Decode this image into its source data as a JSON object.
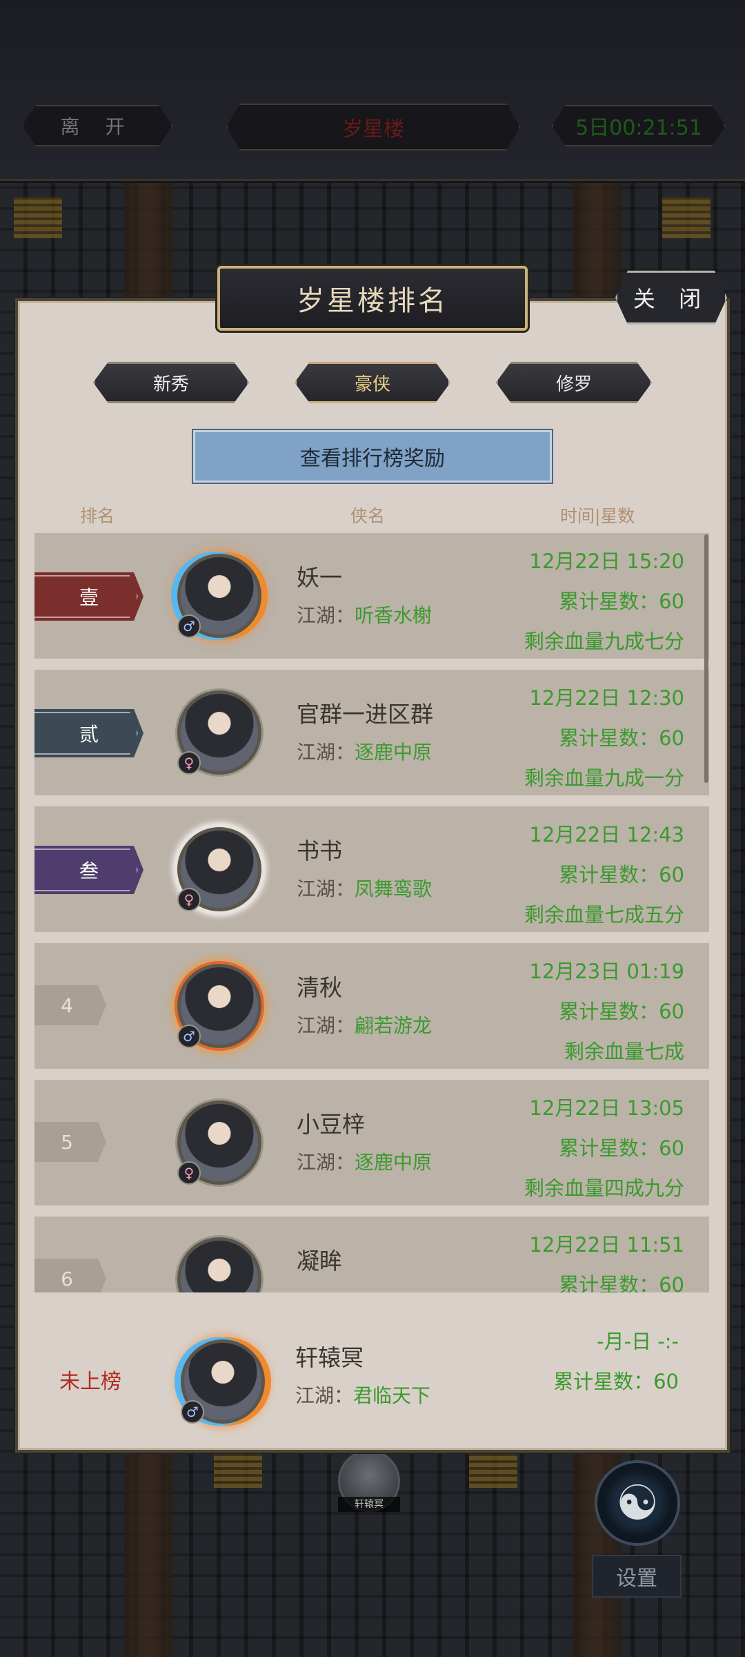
{
  "top_bar": {
    "leave_label": "离 开",
    "location_title": "岁星楼",
    "timer": "5日00:21:51"
  },
  "panel": {
    "title": "岁星楼排名",
    "close_label": "关 闭",
    "tabs": [
      {
        "label": "新秀",
        "active": false
      },
      {
        "label": "豪侠",
        "active": true
      },
      {
        "label": "修罗",
        "active": false
      }
    ],
    "reward_button": "查看排行榜奖励",
    "columns": {
      "rank": "排名",
      "name": "侠名",
      "time": "时间|星数"
    },
    "guild_prefix": "江湖：",
    "rows": [
      {
        "rank": "壹",
        "name": "妖一",
        "guild": "听香水榭",
        "time": "12月22日 15:20",
        "stars": "累计星数：60",
        "hp": "剩余血量九成七分",
        "gender": "♂",
        "frame": "fireice"
      },
      {
        "rank": "贰",
        "name": "官群一进区群",
        "guild": "逐鹿中原",
        "time": "12月22日 12:30",
        "stars": "累计星数：60",
        "hp": "剩余血量九成一分",
        "gender": "♀",
        "frame": "plain"
      },
      {
        "rank": "叁",
        "name": "书书",
        "guild": "凤舞鸾歌",
        "time": "12月22日 12:43",
        "stars": "累计星数：60",
        "hp": "剩余血量七成五分",
        "gender": "♀",
        "frame": "cloud"
      },
      {
        "rank": "4",
        "name": "清秋",
        "guild": "翩若游龙",
        "time": "12月23日 01:19",
        "stars": "累计星数：60",
        "hp": "剩余血量七成",
        "gender": "♂",
        "frame": "fire"
      },
      {
        "rank": "5",
        "name": "小豆梓",
        "guild": "逐鹿中原",
        "time": "12月22日 13:05",
        "stars": "累计星数：60",
        "hp": "剩余血量四成九分",
        "gender": "♀",
        "frame": "plain"
      },
      {
        "rank": "6",
        "name": "凝眸",
        "guild": "",
        "time": "12月22日 11:51",
        "stars": "累计星数：60",
        "hp": "",
        "gender": "♂",
        "frame": "plain"
      }
    ],
    "self": {
      "rank_text": "未上榜",
      "name": "轩辕冥",
      "guild": "君临天下",
      "time": "-月-日 -:-",
      "stars": "累计星数：60",
      "gender": "♂"
    }
  },
  "scene": {
    "avatar_label": "轩辕冥",
    "yinyang_icon": "yin-yang-icon",
    "settings_label": "设置"
  },
  "colors": {
    "rank1": "#7a2f2c",
    "rank2": "#3d4a55",
    "rank3": "#4f3e6d",
    "green_text": "#3a9a2d",
    "unranked_red": "#b02a1e",
    "reward_blue": "#7fa2c6"
  }
}
